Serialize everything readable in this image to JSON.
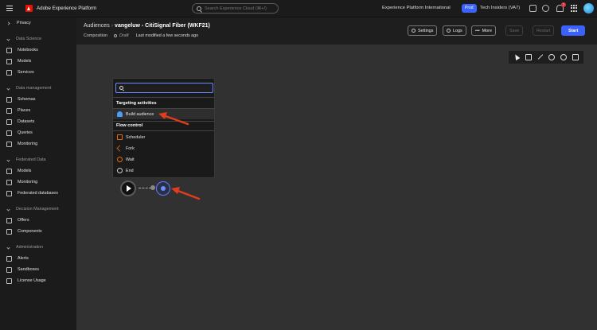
{
  "topbar": {
    "app_title": "Adobe Experience Platform",
    "search_placeholder": "Search Experience Cloud (⌘+/)",
    "org": "Experience Platform International",
    "env_badge": "Prod",
    "sandbox": "Tech Insiders (VA7)",
    "notification_count": "7"
  },
  "sidebar": {
    "privacy": "Privacy",
    "data_science": "Data Science",
    "ds_items": [
      "Notebooks",
      "Models",
      "Services"
    ],
    "data_management": "Data management",
    "dm_items": [
      "Schemas",
      "Places",
      "Datasets",
      "Queries",
      "Monitoring"
    ],
    "federated": "Federated Data",
    "fd_items": [
      "Models",
      "Monitoring",
      "Federated databases"
    ],
    "decision": "Decision Management",
    "dec_items": [
      "Offers",
      "Components"
    ],
    "admin": "Administration",
    "admin_items": [
      "Alerts",
      "Sandboxes",
      "License Usage"
    ]
  },
  "header": {
    "breadcrumb_parent": "Audiences",
    "breadcrumb_current": "vangeluw - CitiSignal Fiber (WKF21)",
    "type": "Composition",
    "status": "Draft",
    "modified": "Last modified a few seconds ago",
    "settings": "Settings",
    "logs": "Logs",
    "more": "More",
    "save": "Save",
    "restart": "Restart",
    "start": "Start"
  },
  "panel": {
    "search_placeholder": "",
    "group_targeting": "Targeting activities",
    "build_audience": "Build audience",
    "group_flow": "Flow control",
    "flow_items": [
      "Scheduler",
      "Fork",
      "Wait",
      "End"
    ]
  },
  "colors": {
    "accent": "#3b63fb",
    "annotation": "#e33b1e",
    "flow_icon": "#e36c0a"
  }
}
